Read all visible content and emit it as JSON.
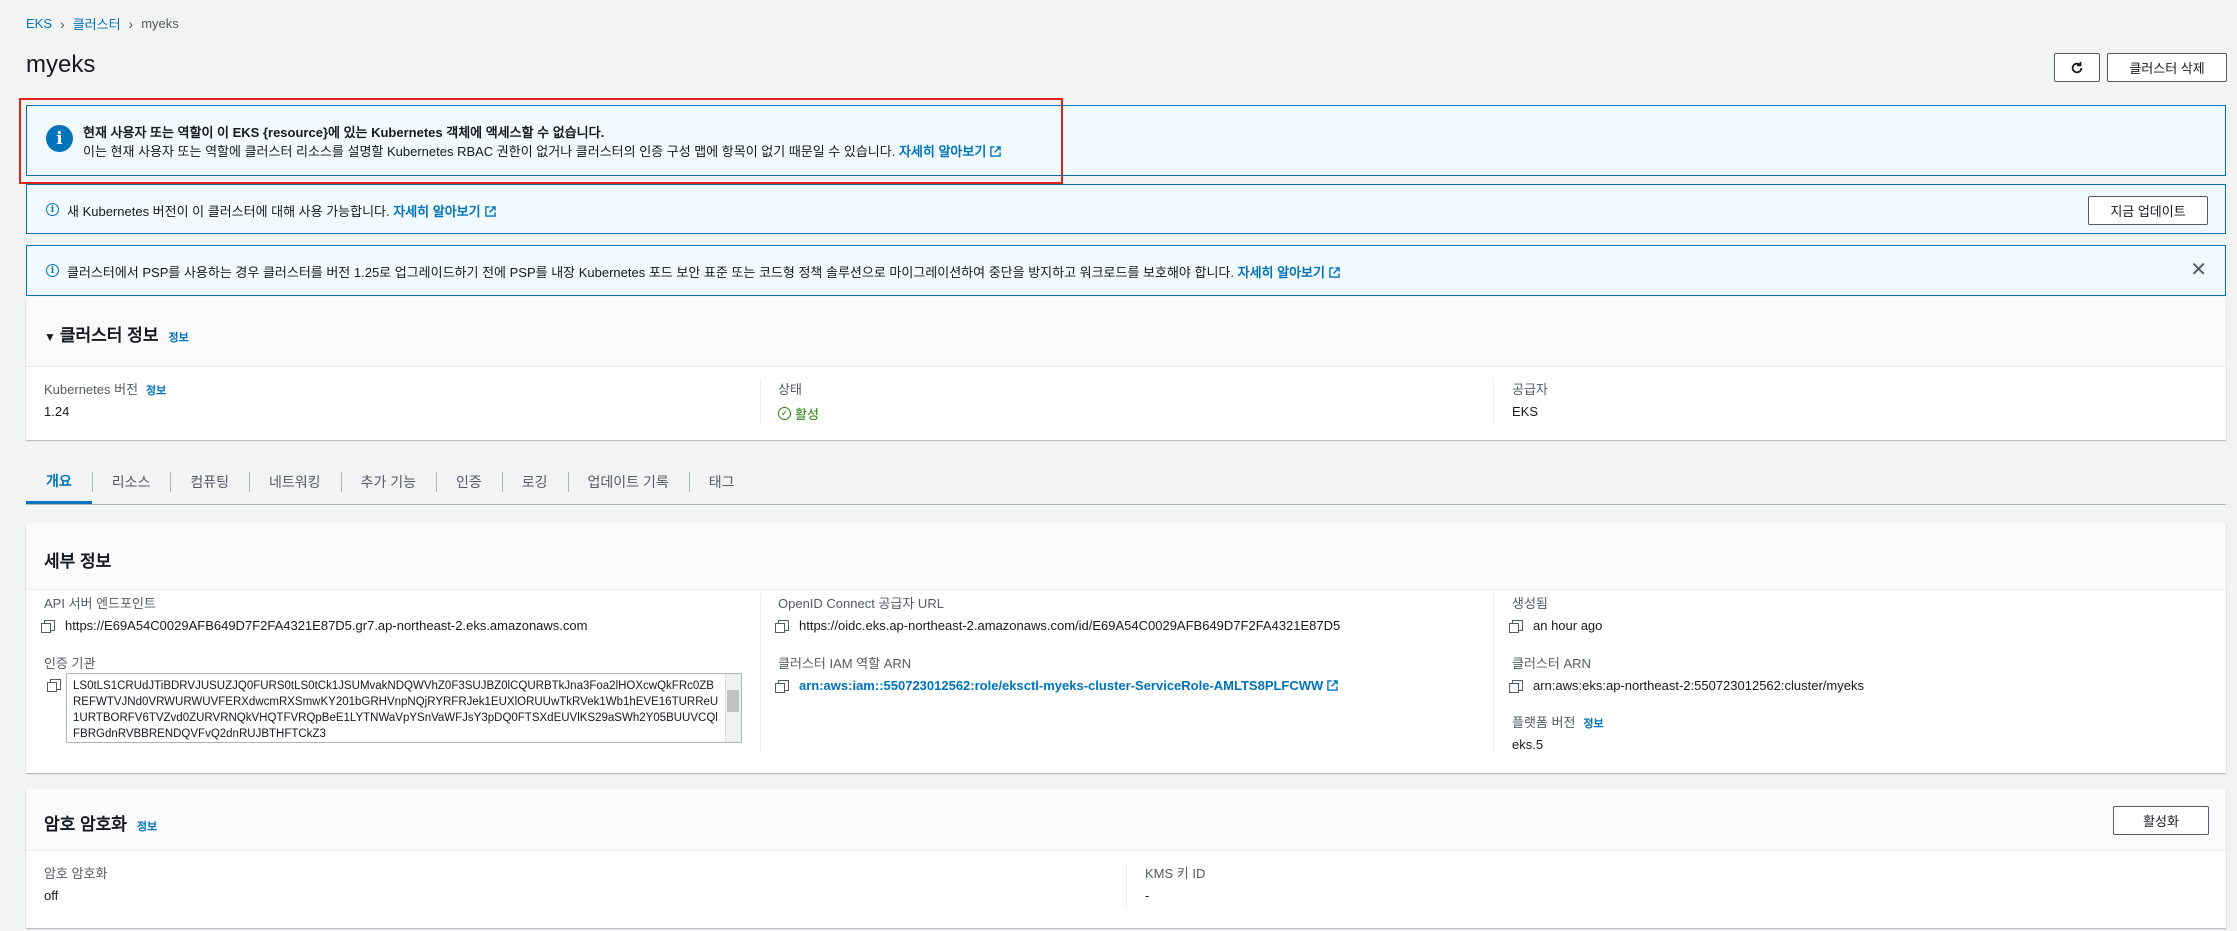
{
  "breadcrumb": {
    "eks": "EKS",
    "clusters": "클러스터",
    "current": "myeks"
  },
  "page_title": "myeks",
  "header": {
    "delete_label": "클러스터 삭제"
  },
  "banner_access": {
    "title": "현재 사용자 또는 역할이 이 EKS {resource}에 있는 Kubernetes 객체에 액세스할 수 없습니다.",
    "body": "이는 현재 사용자 또는 역할에 클러스터 리소스를 설명할 Kubernetes RBAC 권한이 없거나 클러스터의 인증 구성 맵에 항목이 없기 때문일 수 있습니다.",
    "link": "자세히 알아보기"
  },
  "banner_version": {
    "text": "새 Kubernetes 버전이 이 클러스터에 대해 사용 가능합니다.",
    "link": "자세히 알아보기",
    "button": "지금 업데이트"
  },
  "banner_psp": {
    "text": "클러스터에서 PSP를 사용하는 경우 클러스터를 버전 1.25로 업그레이드하기 전에 PSP를 내장 Kubernetes 포드 보안 표준 또는 코드형 정책 솔루션으로 마이그레이션하여 중단을 방지하고 워크로드를 보호해야 합니다.",
    "link": "자세히 알아보기"
  },
  "cluster_info": {
    "title": "클러스터 정보",
    "info": "정보",
    "k8s_version_label": "Kubernetes 버전",
    "k8s_version_info": "정보",
    "k8s_version": "1.24",
    "status_label": "상태",
    "status": "활성",
    "provider_label": "공급자",
    "provider": "EKS"
  },
  "tabs": [
    "개요",
    "리소스",
    "컴퓨팅",
    "네트워킹",
    "추가 기능",
    "인증",
    "로깅",
    "업데이트 기록",
    "태그"
  ],
  "details": {
    "title": "세부 정보",
    "api_label": "API 서버 엔드포인트",
    "api": "https://E69A54C0029AFB649D7F2FA4321E87D5.gr7.ap-northeast-2.eks.amazonaws.com",
    "oidc_label": "OpenID Connect 공급자 URL",
    "oidc": "https://oidc.eks.ap-northeast-2.amazonaws.com/id/E69A54C0029AFB649D7F2FA4321E87D5",
    "created_label": "생성됨",
    "created": "an hour ago",
    "cert_label": "인증 기관",
    "cert": "LS0tLS1CRUdJTiBDRVJUSUZJQ0FURS0tLS0tCk1JSUMvakNDQWVhZ0F3SUJBZ0lCQURBTkJna3Foa2lHOXcwQkFRc0ZBREFWTVJNd0VRWURWUVFERXdwcmRXSmwKY201bGRHVnpNQjRYRFRJek1EUXlORUUwTkRVek1Wb1hEVE16TURReU1URTBORFV6TVZvd0ZURVRNQkVHQTFVRQpBeE1LYTNWaVpYSnVaWFJsY3pDQ0FTSXdEUVlKS29aSWh2Y05BUUVCQlFBRGdnRVBBRENDQVFvQ2dnRUJBTHFTCkZ3",
    "role_label": "클러스터 IAM 역할 ARN",
    "role": "arn:aws:iam::550723012562:role/eksctl-myeks-cluster-ServiceRole-AMLTS8PLFCWW",
    "arn_label": "클러스터 ARN",
    "arn": "arn:aws:eks:ap-northeast-2:550723012562:cluster/myeks",
    "platform_label": "플랫폼 버전",
    "platform_info": "정보",
    "platform": "eks.5"
  },
  "secrets": {
    "title": "암호 암호화",
    "info": "정보",
    "button": "활성화",
    "enc_label": "암호 암호화",
    "enc": "off",
    "kms_label": "KMS 키 ID",
    "kms": "-"
  }
}
